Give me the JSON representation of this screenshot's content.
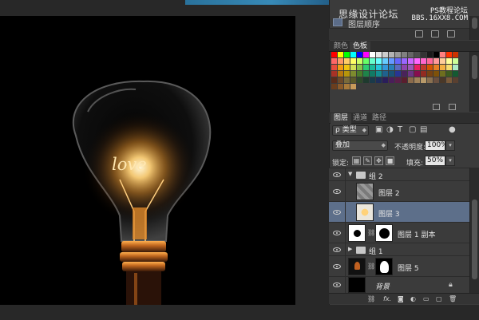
{
  "watermark": {
    "main": "思缘设计论坛",
    "brand": "PS教程论坛",
    "url": "BBS.16XX8.COM"
  },
  "history": {
    "item_label": "图层顺序"
  },
  "swatches": {
    "tabs": [
      "颜色",
      "色板"
    ],
    "colors": [
      "#ff0000",
      "#ffff00",
      "#00ff00",
      "#00ffff",
      "#0000ff",
      "#ff00ff",
      "#ffffff",
      "#e6e6e6",
      "#cccccc",
      "#b3b3b3",
      "#999999",
      "#808080",
      "#666666",
      "#4d4d4d",
      "#333333",
      "#1a1a1a",
      "#000000",
      "#ff8080",
      "#ff3300",
      "#cc3300",
      "#ff6666",
      "#ff9966",
      "#ffcc66",
      "#ffff66",
      "#ccff66",
      "#66ff66",
      "#66ffcc",
      "#66ffff",
      "#66ccff",
      "#6699ff",
      "#6666ff",
      "#9966ff",
      "#cc66ff",
      "#ff66ff",
      "#ff66cc",
      "#ff6699",
      "#ff9999",
      "#ffcc99",
      "#ffff99",
      "#ccff99",
      "#e84c3d",
      "#f39c12",
      "#f1c40f",
      "#d4e157",
      "#8bc34a",
      "#2ecc71",
      "#1abc9c",
      "#26c6da",
      "#3498db",
      "#2980b9",
      "#5c6bc0",
      "#8e44ad",
      "#9b59b6",
      "#e91e63",
      "#c0392b",
      "#d35400",
      "#e67e22",
      "#f5b041",
      "#f7dc6f",
      "#abebc6",
      "#a93226",
      "#b9770e",
      "#b7950b",
      "#7d8c2e",
      "#4a7c2a",
      "#1e8449",
      "#117a65",
      "#138d90",
      "#1f618d",
      "#1a5276",
      "#283593",
      "#4a235a",
      "#6c3483",
      "#880e4f",
      "#922b21",
      "#784212",
      "#7e5109",
      "#6e6e1e",
      "#3d5c1e",
      "#145a32",
      "#5b2c1a",
      "#6e4a2a",
      "#7a6a3a",
      "#5a5a2a",
      "#2e4a2a",
      "#1e3a2e",
      "#1a3a4a",
      "#1e2e5a",
      "#2a1e5a",
      "#4a1e5a",
      "#5a1e4a",
      "#5a1e2e",
      "#8b6b4b",
      "#a0825a",
      "#b89a6a",
      "#8a7050",
      "#6a5040",
      "#4a3828",
      "#7a5a3a",
      "#5a4030",
      "#6b3e1e",
      "#8a5a2a",
      "#a87a3a",
      "#c89a5a"
    ]
  },
  "layers_panel": {
    "tabs": [
      "图层",
      "通道",
      "路径"
    ],
    "filter_label": "ρ 类型",
    "blend_mode": "叠加",
    "opacity_label": "不透明度:",
    "opacity_value": "100%",
    "lock_label": "锁定:",
    "fill_label": "填充:",
    "fill_value": "50%",
    "layers": [
      {
        "name": "组 2",
        "kind": "group",
        "expanded": true
      },
      {
        "name": "图层 2",
        "kind": "layer"
      },
      {
        "name": "图层 3",
        "kind": "layer",
        "selected": true
      },
      {
        "name": "图层 1 副本",
        "kind": "masked"
      },
      {
        "name": "组 1",
        "kind": "group",
        "expanded": false
      },
      {
        "name": "图层 5",
        "kind": "masked"
      },
      {
        "name": "背景",
        "kind": "background",
        "locked": true
      }
    ],
    "footer_fx": "fx."
  },
  "canvas": {
    "text": "love"
  },
  "colors": {
    "selection": "#5d6f8a",
    "panel": "#3b3b3b",
    "glow": "#ffb347"
  }
}
